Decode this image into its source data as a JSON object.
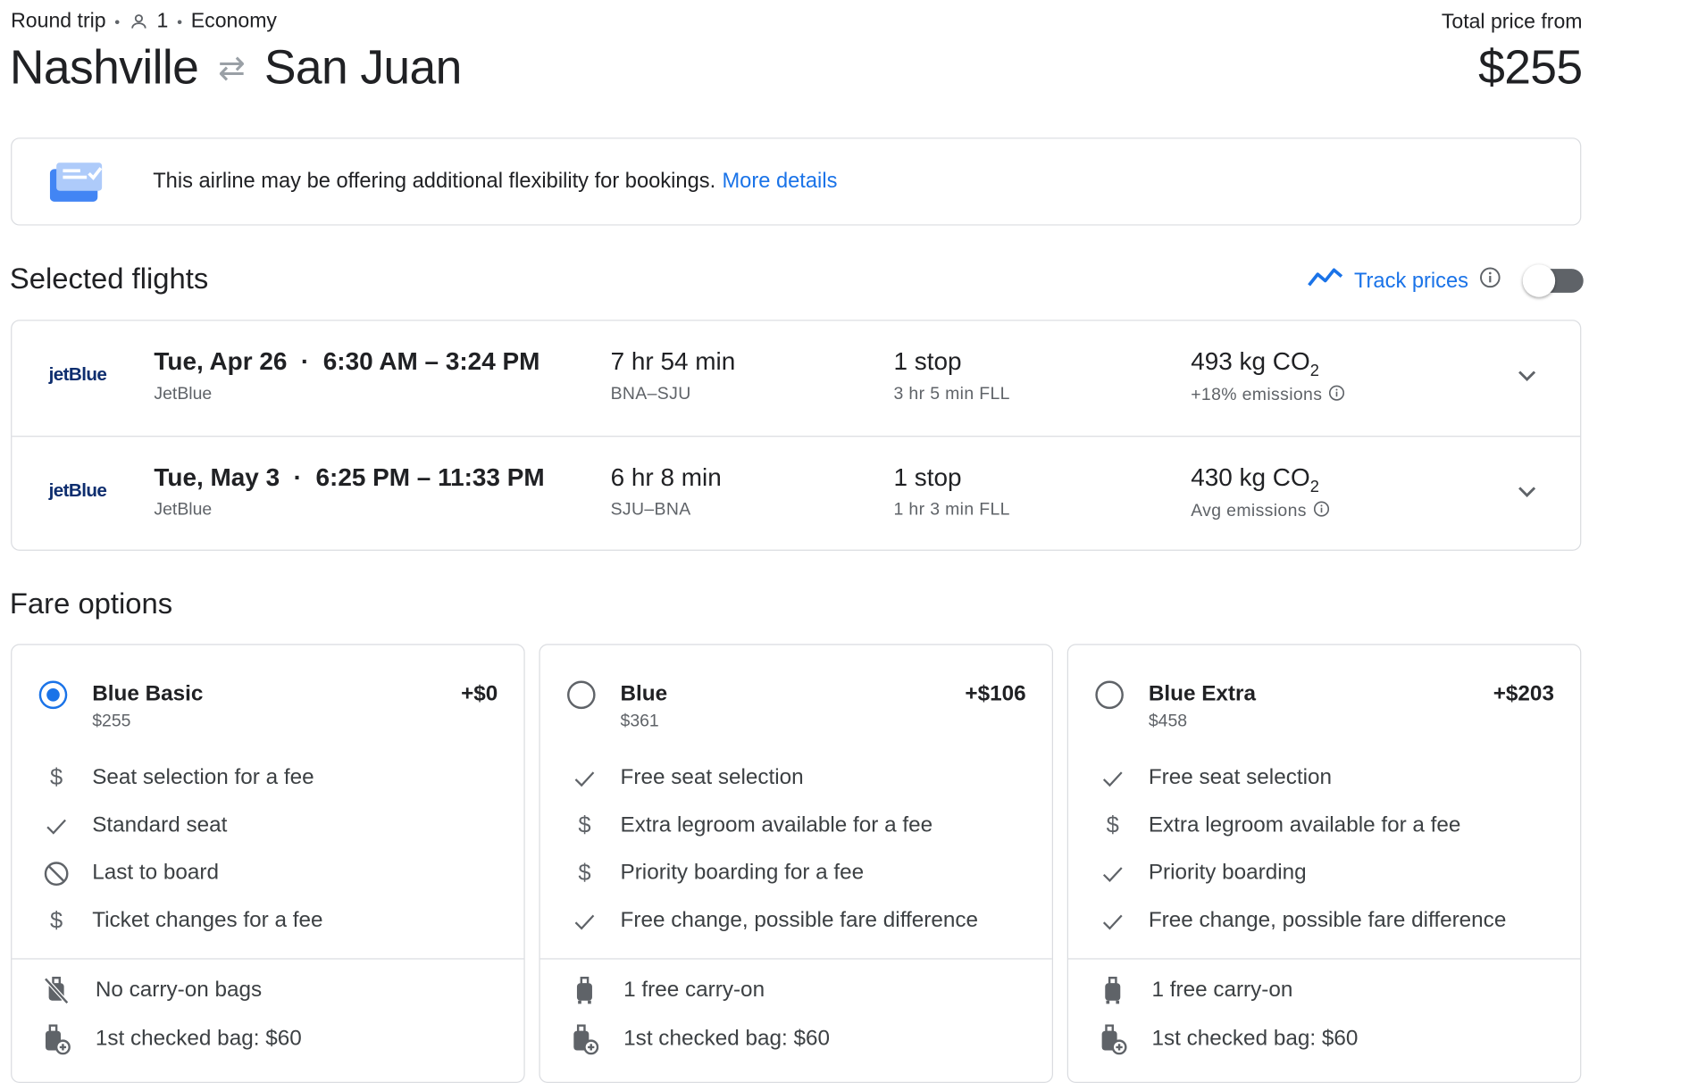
{
  "header": {
    "trip_type": "Round trip",
    "passengers": "1",
    "cabin": "Economy",
    "origin": "Nashville",
    "destination": "San Juan",
    "price_label": "Total price from",
    "price": "$255"
  },
  "banner": {
    "text": "This airline may be offering additional flexibility for bookings.",
    "link": "More details"
  },
  "selected": {
    "title": "Selected flights",
    "track_label": "Track prices",
    "track_on": false
  },
  "flights": [
    {
      "logo": "jetBlue",
      "date": "Tue, Apr 26",
      "times": "6:30 AM – 3:24 PM",
      "airline": "JetBlue",
      "duration": "7 hr 54 min",
      "route": "BNA–SJU",
      "stops": "1 stop",
      "layover": "3 hr 5 min FLL",
      "co2": "493 kg CO",
      "co2_sub": "2",
      "emissions": "+18% emissions"
    },
    {
      "logo": "jetBlue",
      "date": "Tue, May 3",
      "times": "6:25 PM – 11:33 PM",
      "airline": "JetBlue",
      "duration": "6 hr 8 min",
      "route": "SJU–BNA",
      "stops": "1 stop",
      "layover": "1 hr 3 min FLL",
      "co2": "430 kg CO",
      "co2_sub": "2",
      "emissions": "Avg emissions"
    }
  ],
  "fares": {
    "title": "Fare options",
    "options": [
      {
        "name": "Blue Basic",
        "price": "$255",
        "delta": "+$0",
        "selected": true,
        "features": [
          {
            "icon": "dollar-icon",
            "text": "Seat selection for a fee"
          },
          {
            "icon": "check-icon",
            "text": "Standard seat"
          },
          {
            "icon": "no-icon",
            "text": "Last to board"
          },
          {
            "icon": "dollar-icon",
            "text": "Ticket changes for a fee"
          }
        ],
        "bags": [
          {
            "icon": "no-carry-on-icon",
            "text": "No carry-on bags"
          },
          {
            "icon": "checked-bag-icon",
            "text": "1st checked bag: $60"
          }
        ]
      },
      {
        "name": "Blue",
        "price": "$361",
        "delta": "+$106",
        "selected": false,
        "features": [
          {
            "icon": "check-icon",
            "text": "Free seat selection"
          },
          {
            "icon": "dollar-icon",
            "text": "Extra legroom available for a fee"
          },
          {
            "icon": "dollar-icon",
            "text": "Priority boarding for a fee"
          },
          {
            "icon": "check-icon",
            "text": "Free change, possible fare difference"
          }
        ],
        "bags": [
          {
            "icon": "carry-on-icon",
            "text": "1 free carry-on"
          },
          {
            "icon": "checked-bag-icon",
            "text": "1st checked bag: $60"
          }
        ]
      },
      {
        "name": "Blue Extra",
        "price": "$458",
        "delta": "+$203",
        "selected": false,
        "features": [
          {
            "icon": "check-icon",
            "text": "Free seat selection"
          },
          {
            "icon": "dollar-icon",
            "text": "Extra legroom available for a fee"
          },
          {
            "icon": "check-icon",
            "text": "Priority boarding"
          },
          {
            "icon": "check-icon",
            "text": "Free change, possible fare difference"
          }
        ],
        "bags": [
          {
            "icon": "carry-on-icon",
            "text": "1 free carry-on"
          },
          {
            "icon": "checked-bag-icon",
            "text": "1st checked bag: $60"
          }
        ]
      }
    ]
  },
  "colors": {
    "accent": "#1a73e8",
    "text": "#202124",
    "muted": "#5f6368",
    "border": "#dadce0"
  }
}
